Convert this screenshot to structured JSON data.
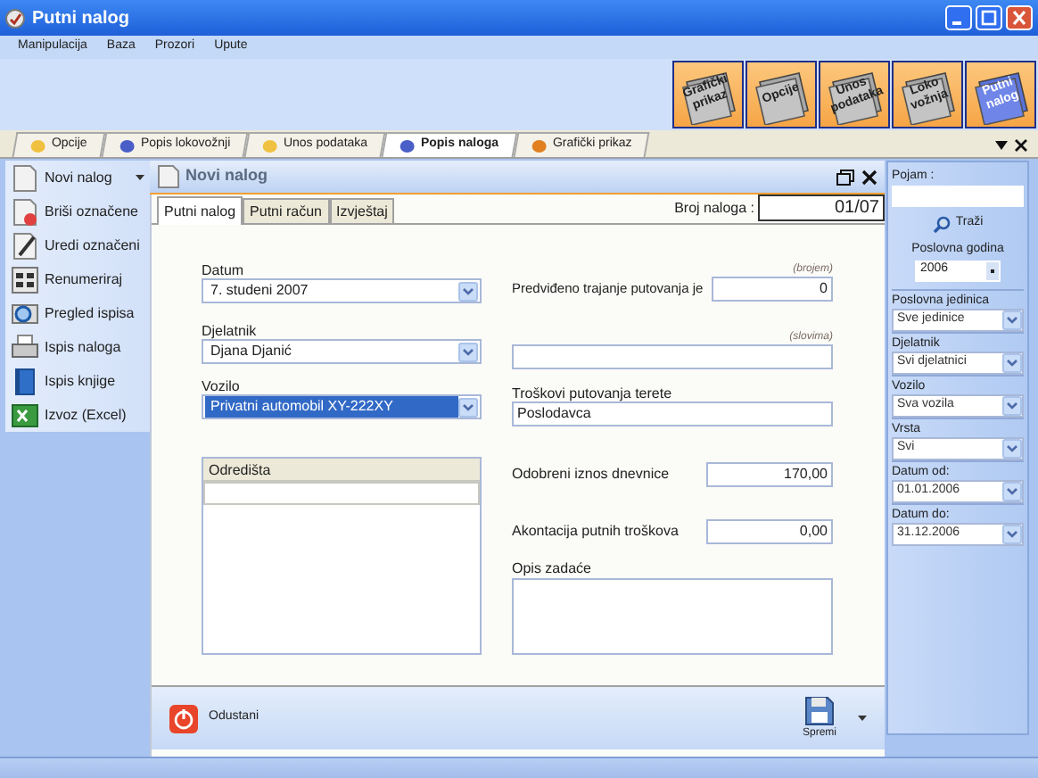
{
  "window": {
    "title": "Putni nalog"
  },
  "menu": [
    "Manipulacija",
    "Baza",
    "Prozori",
    "Upute"
  ],
  "toolbar_buttons": [
    {
      "label": "Grafički prikaz",
      "selected": false
    },
    {
      "label": "Opcije",
      "selected": false
    },
    {
      "label": "Unos podataka",
      "selected": false
    },
    {
      "label": "Loko vožnja",
      "selected": false
    },
    {
      "label": "Putni nalog",
      "selected": true
    }
  ],
  "tabs": [
    {
      "label": "Opcije",
      "selected": false
    },
    {
      "label": "Popis lokovožnji",
      "selected": false
    },
    {
      "label": "Unos podataka",
      "selected": false
    },
    {
      "label": "Popis naloga",
      "selected": true
    },
    {
      "label": "Grafički prikaz",
      "selected": false
    }
  ],
  "sidebar": {
    "items": [
      {
        "label": "Novi nalog",
        "has_menu": true
      },
      {
        "label": "Briši označene",
        "has_menu": false
      },
      {
        "label": "Uredi označeni",
        "has_menu": false
      },
      {
        "label": "Renumeriraj",
        "has_menu": false
      },
      {
        "label": "Pregled ispisa",
        "has_menu": false
      },
      {
        "label": "Ispis naloga",
        "has_menu": false
      },
      {
        "label": "Ispis knjige",
        "has_menu": false
      },
      {
        "label": "Izvoz (Excel)",
        "has_menu": false
      }
    ]
  },
  "panel": {
    "title": "Novi nalog",
    "subtabs": [
      {
        "label": "Putni nalog",
        "selected": true
      },
      {
        "label": "Putni račun",
        "selected": false
      },
      {
        "label": "Izvještaj",
        "selected": false
      }
    ],
    "number_label": "Broj naloga :",
    "number_value": "01/07",
    "datum": {
      "label": "Datum",
      "value": "7. studeni 2007"
    },
    "djelatnik": {
      "label": "Djelatnik",
      "value": "Djana Djanić"
    },
    "vozilo": {
      "label": "Vozilo",
      "value": "Privatni automobil XY-222XY",
      "selected": true
    },
    "destinations": {
      "header": "Odredišta"
    },
    "duration": {
      "hint": "(brojem)",
      "label": "Predviđeno trajanje putovanja je",
      "value": "0"
    },
    "duration_words": {
      "hint": "(slovima)"
    },
    "costs": {
      "label": "Troškovi putovanja terete",
      "value": "Poslodavca"
    },
    "allowance": {
      "label": "Odobreni iznos dnevnice",
      "value": "170,00"
    },
    "advance": {
      "label": "Akontacija putnih troškova",
      "value": "0,00"
    },
    "task": {
      "label": "Opis zadaće"
    },
    "cancel_button": "Odustani",
    "save_button": "Spremi"
  },
  "filter_panel": {
    "search_label": "Pojam :",
    "search_button": "Traži",
    "year_label": "Poslovna godina",
    "year_value": "2006",
    "filters": [
      {
        "label": "Poslovna jedinica",
        "value": "Sve jedinice"
      },
      {
        "label": "Djelatnik",
        "value": "Svi djelatnici"
      },
      {
        "label": "Vozilo",
        "value": "Sva vozila"
      },
      {
        "label": "Vrsta",
        "value": "Svi"
      },
      {
        "label": "Datum od:",
        "value": "01.01.2006"
      },
      {
        "label": "Datum do:",
        "value": "31.12.2006"
      }
    ]
  }
}
